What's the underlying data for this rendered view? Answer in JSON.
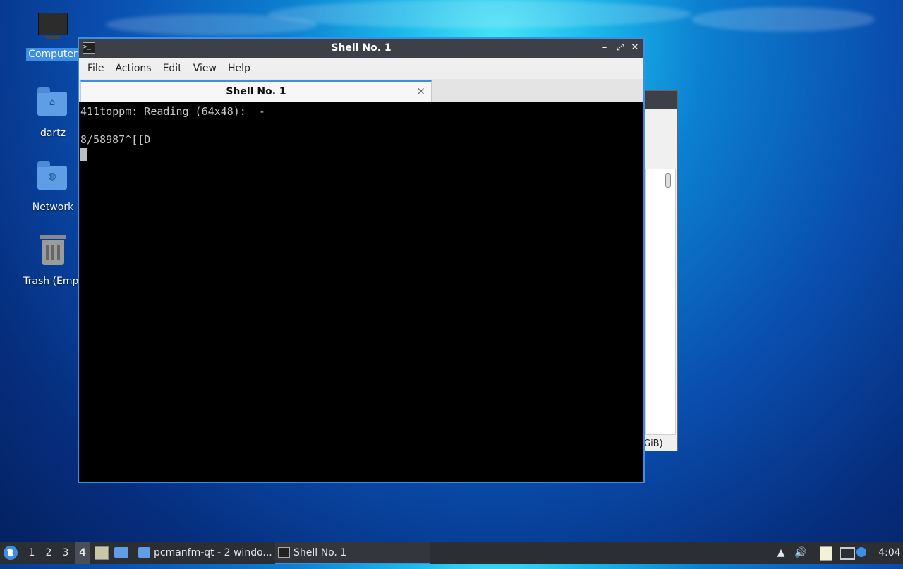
{
  "desktop": {
    "icons": [
      {
        "label": "Computer"
      },
      {
        "label": "dartz"
      },
      {
        "label": "Network"
      },
      {
        "label": "Trash (Empt"
      }
    ]
  },
  "background_window": {
    "status_text": "GiB)"
  },
  "terminal_window": {
    "title": "Shell No. 1",
    "app_icon_glyph": ">_",
    "controls": {
      "minimize": "–",
      "maximize": "⤢",
      "close": "✕"
    },
    "menu": [
      "File",
      "Actions",
      "Edit",
      "View",
      "Help"
    ],
    "tab": {
      "label": "Shell No. 1",
      "close": "×"
    },
    "lines": [
      "411toppm: Reading (64x48):  -",
      "",
      "8/58987^[[D"
    ]
  },
  "taskbar": {
    "workspaces": [
      "1",
      "2",
      "3",
      "4"
    ],
    "active_workspace": "4",
    "tasks": [
      {
        "label": "pcmanfm-qt - 2 windo..."
      },
      {
        "label": "Shell No. 1"
      }
    ],
    "clock": "4:04"
  },
  "colors": {
    "accent": "#3d8ee6",
    "titlebar": "#3d4047",
    "taskbar": "#2b2e33",
    "terminal_bg": "#000000",
    "terminal_fg": "#c8c8c8"
  }
}
